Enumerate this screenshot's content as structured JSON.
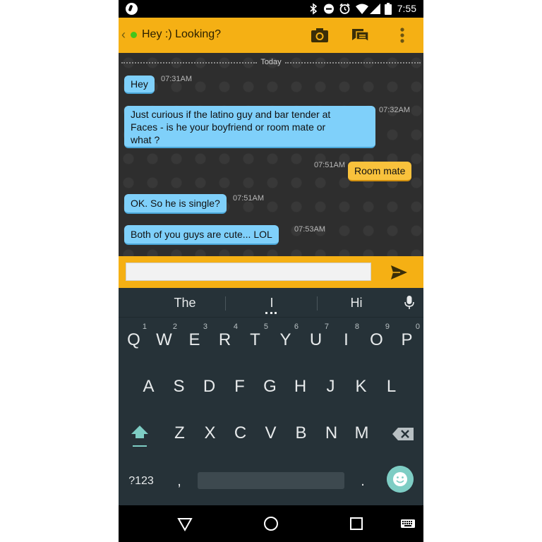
{
  "status_bar": {
    "time": "7:55",
    "icons": [
      "app-notification-icon",
      "bluetooth-icon",
      "do-not-disturb-icon",
      "alarm-icon",
      "wifi-icon",
      "signal-icon",
      "battery-icon"
    ]
  },
  "app_bar": {
    "back_icon": "chevron-left-icon",
    "title": "Hey :) Looking?",
    "actions": [
      "camera-icon",
      "saved-phrases-icon",
      "overflow-menu-icon"
    ],
    "online_color": "#43c61b",
    "bar_color": "#f5b014"
  },
  "chat": {
    "date_divider": "Today",
    "messages": [
      {
        "direction": "in",
        "text": "Hey",
        "time": "07:31AM"
      },
      {
        "direction": "in",
        "lines": [
          "Just curious if the latino guy and bar tender at",
          "Faces - is he your boyfriend or room mate or",
          "what ?"
        ],
        "time": "07:32AM"
      },
      {
        "direction": "out",
        "text": "Room mate",
        "time": "07:51AM"
      },
      {
        "direction": "in",
        "text": "OK. So he is single?",
        "time": "07:51AM"
      },
      {
        "direction": "in",
        "text": "Both of you guys are cute... LOL",
        "time": "07:53AM"
      }
    ],
    "incoming_color": "#7fd0fa",
    "outgoing_color": "#f9c23c"
  },
  "composer": {
    "input_value": "",
    "send_icon": "send-icon"
  },
  "keyboard": {
    "suggestions": [
      "The",
      "I",
      "Hi"
    ],
    "mic_icon": "mic-icon",
    "row1": [
      {
        "key": "Q",
        "hint": "1"
      },
      {
        "key": "W",
        "hint": "2"
      },
      {
        "key": "E",
        "hint": "3"
      },
      {
        "key": "R",
        "hint": "4"
      },
      {
        "key": "T",
        "hint": "5"
      },
      {
        "key": "Y",
        "hint": "6"
      },
      {
        "key": "U",
        "hint": "7"
      },
      {
        "key": "I",
        "hint": "8"
      },
      {
        "key": "O",
        "hint": "9"
      },
      {
        "key": "P",
        "hint": "0"
      }
    ],
    "row2": [
      "A",
      "S",
      "D",
      "F",
      "G",
      "H",
      "J",
      "K",
      "L"
    ],
    "row3": [
      "Z",
      "X",
      "C",
      "V",
      "B",
      "N",
      "M"
    ],
    "symbols_label": "?123",
    "comma": ",",
    "period": ".",
    "shift_icon": "shift-icon",
    "backspace_icon": "backspace-icon",
    "emoji_icon": "emoji-icon",
    "accent_color": "#7ecdc4"
  },
  "nav_bar": {
    "buttons": [
      "back-triangle-icon",
      "home-circle-icon",
      "recents-square-icon",
      "keyboard-switch-icon"
    ]
  }
}
